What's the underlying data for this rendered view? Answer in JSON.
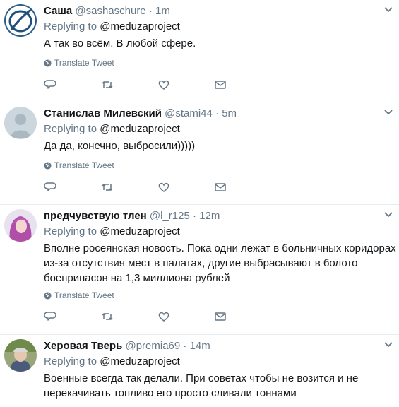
{
  "colors": {
    "text": "#14171a",
    "secondary": "#657786",
    "divider": "#e6ecf0"
  },
  "icons": {
    "more": "chevron-down-icon",
    "globe": "globe-icon",
    "reply": "reply-icon",
    "retweet": "retweet-icon",
    "like": "heart-icon",
    "dm": "envelope-icon"
  },
  "tweets": [
    {
      "name": "Саша",
      "handle": "@sashaschure",
      "dot": "·",
      "time": "1m",
      "reply_prefix": "Replying to",
      "reply_to": "@meduzaproject",
      "text": "А так во всём. В любой сфере.",
      "translate": "Translate Tweet"
    },
    {
      "name": "Станислав Милевский",
      "handle": "@stami44",
      "dot": "·",
      "time": "5m",
      "reply_prefix": "Replying to",
      "reply_to": "@meduzaproject",
      "text": "Да да, конечно, выбросили)))))",
      "translate": "Translate Tweet"
    },
    {
      "name": "предчувствую тлен",
      "handle": "@l_r125",
      "dot": "·",
      "time": "12m",
      "reply_prefix": "Replying to",
      "reply_to": "@meduzaproject",
      "text": "Вполне росеянская новость. Пока одни лежат в больничных коридорах из-за отсутствия мест в палатах, другие выбрасывают в болото боеприпасов на 1,3 миллиона рублей",
      "translate": "Translate Tweet"
    },
    {
      "name": "Херовая Тверь",
      "handle": "@premia69",
      "dot": "·",
      "time": "14m",
      "reply_prefix": "Replying to",
      "reply_to": "@meduzaproject",
      "text": "Военные всегда так делали. При советах чтобы не возится и не перекачивать топливо его просто сливали тоннами"
    }
  ]
}
